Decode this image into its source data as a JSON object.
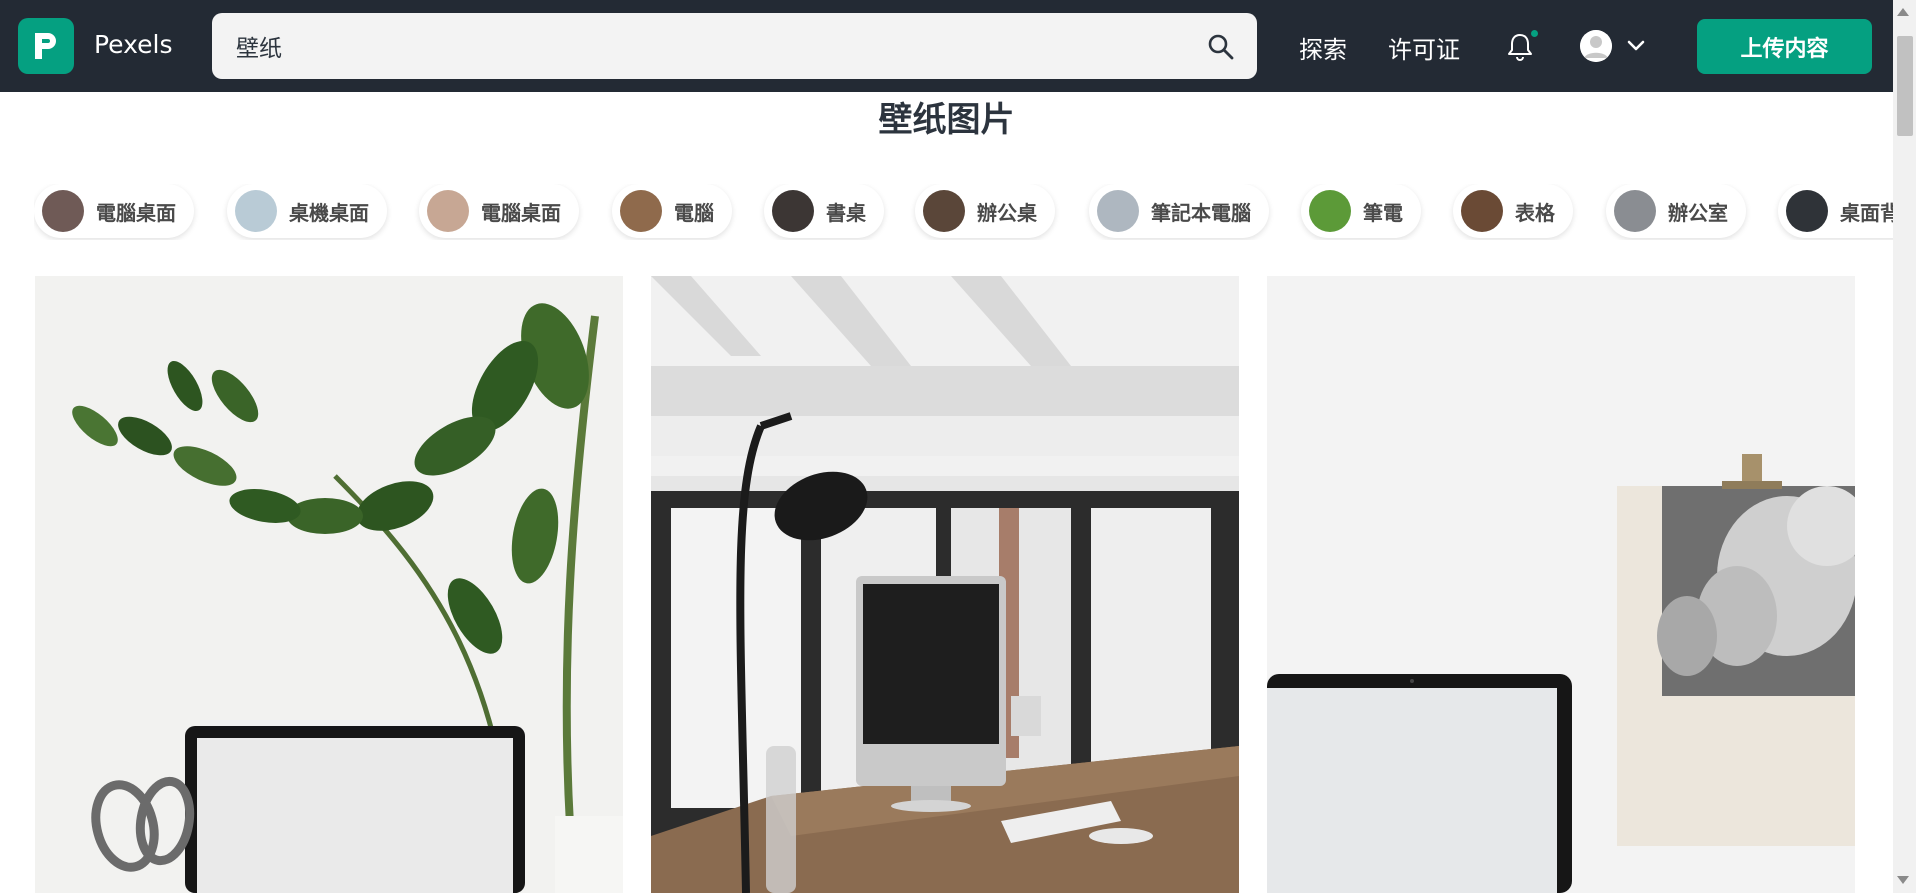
{
  "header": {
    "brand": "Pexels",
    "search": {
      "value": "壁纸"
    },
    "nav": {
      "explore": "探索",
      "license": "许可证"
    },
    "upload_label": "上传内容",
    "colors": {
      "bar": "#232a34",
      "accent": "#05a081"
    }
  },
  "page": {
    "title": "壁纸图片"
  },
  "chips": [
    {
      "label": "電腦桌面",
      "thumb": "#6f5a56"
    },
    {
      "label": "桌機桌面",
      "thumb": "#b9cbd6"
    },
    {
      "label": "電腦桌面",
      "thumb": "#c7a794"
    },
    {
      "label": "電腦",
      "thumb": "#8f6a4c"
    },
    {
      "label": "書桌",
      "thumb": "#3c3634"
    },
    {
      "label": "辦公桌",
      "thumb": "#5a4639"
    },
    {
      "label": "筆記本電腦",
      "thumb": "#aeb7c0"
    },
    {
      "label": "筆電",
      "thumb": "#5c9a38"
    },
    {
      "label": "表格",
      "thumb": "#6a4a35"
    },
    {
      "label": "辦公室",
      "thumb": "#8a8d92"
    },
    {
      "label": "桌面背景",
      "thumb": "#2f3338"
    }
  ],
  "photos": [
    {
      "subject": "plant-laptop"
    },
    {
      "subject": "lamp-imac-desk"
    },
    {
      "subject": "laptop-statue-print"
    }
  ]
}
